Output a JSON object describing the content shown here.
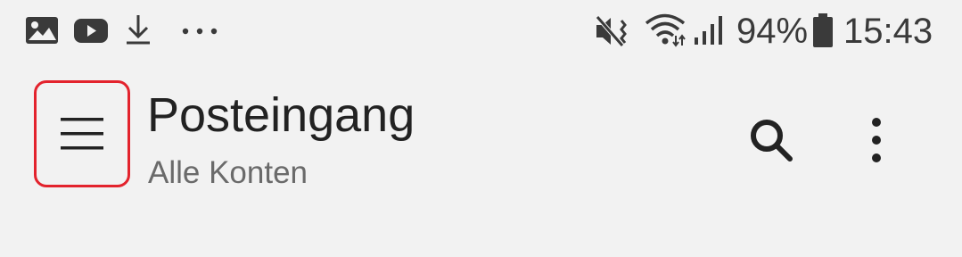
{
  "status_bar": {
    "notification_icons": [
      "image-icon",
      "youtube-icon",
      "download-icon",
      "more-notifications-icon"
    ],
    "system_icons": [
      "vibrate-mute-icon",
      "wifi-icon",
      "signal-icon",
      "battery-icon"
    ],
    "battery_percent": "94%",
    "time": "15:43"
  },
  "toolbar": {
    "title": "Posteingang",
    "subtitle": "Alle Konten",
    "actions": [
      "menu-icon",
      "search-icon",
      "more-vertical-icon"
    ]
  },
  "colors": {
    "background": "#f2f2f2",
    "highlight": "#e3232d",
    "text_primary": "#222222",
    "text_secondary": "#6a6a6a"
  }
}
